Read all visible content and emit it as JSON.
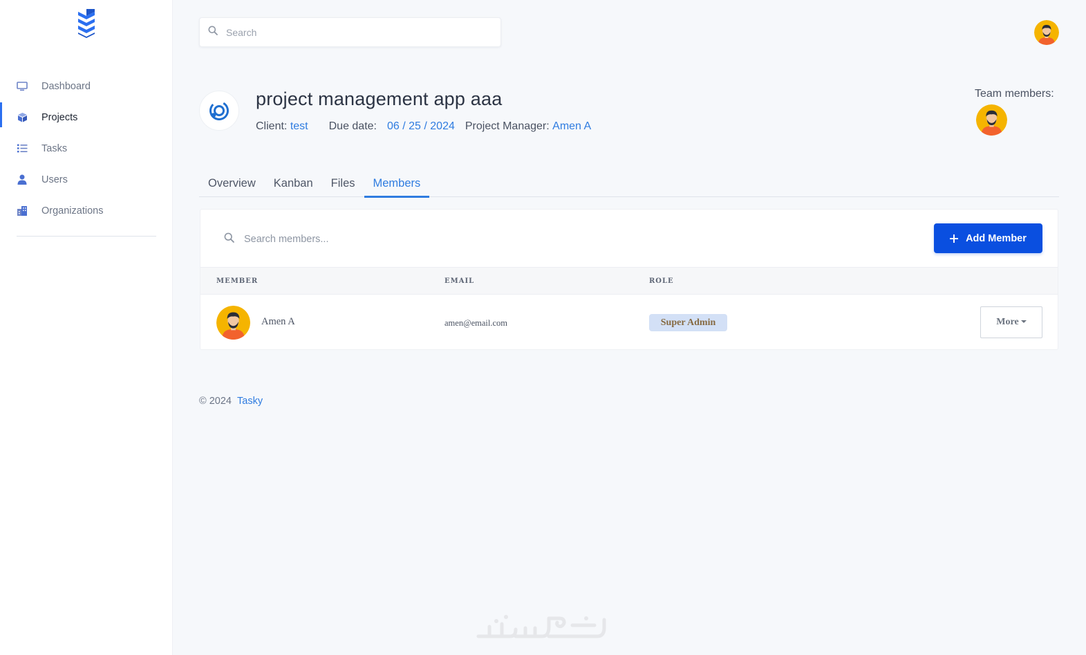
{
  "sidebar": {
    "items": [
      {
        "label": "Dashboard",
        "icon": "monitor-icon",
        "active": false
      },
      {
        "label": "Projects",
        "icon": "cube-icon",
        "active": true
      },
      {
        "label": "Tasks",
        "icon": "list-icon",
        "active": false
      },
      {
        "label": "Users",
        "icon": "user-icon",
        "active": false
      },
      {
        "label": "Organizations",
        "icon": "building-icon",
        "active": false
      }
    ]
  },
  "topbar": {
    "search_placeholder": "Search"
  },
  "project": {
    "title": "project management app aaa",
    "client_label": "Client:",
    "client_value": "test",
    "due_label": "Due date:",
    "due_value": "06 / 25 / 2024",
    "manager_label": "Project Manager:",
    "manager_value": "Amen A",
    "team_label": "Team members:"
  },
  "tabs": [
    {
      "label": "Overview",
      "active": false
    },
    {
      "label": "Kanban",
      "active": false
    },
    {
      "label": "Files",
      "active": false
    },
    {
      "label": "Members",
      "active": true
    }
  ],
  "members": {
    "search_placeholder": "Search members...",
    "add_button_label": "Add Member",
    "columns": [
      "MEMBER",
      "EMAIL",
      "ROLE"
    ],
    "rows": [
      {
        "name": "Amen A",
        "email": "amen@email.com",
        "role": "Super Admin",
        "action_label": "More"
      }
    ]
  },
  "footer": {
    "copyright": "© 2024",
    "brand": "Tasky"
  },
  "colors": {
    "accent": "#2f7ce0",
    "primary_button": "#0a4fe0",
    "role_badge_bg": "#d3e0f6",
    "role_badge_text": "#866a42",
    "page_bg": "#f6f8fb"
  }
}
